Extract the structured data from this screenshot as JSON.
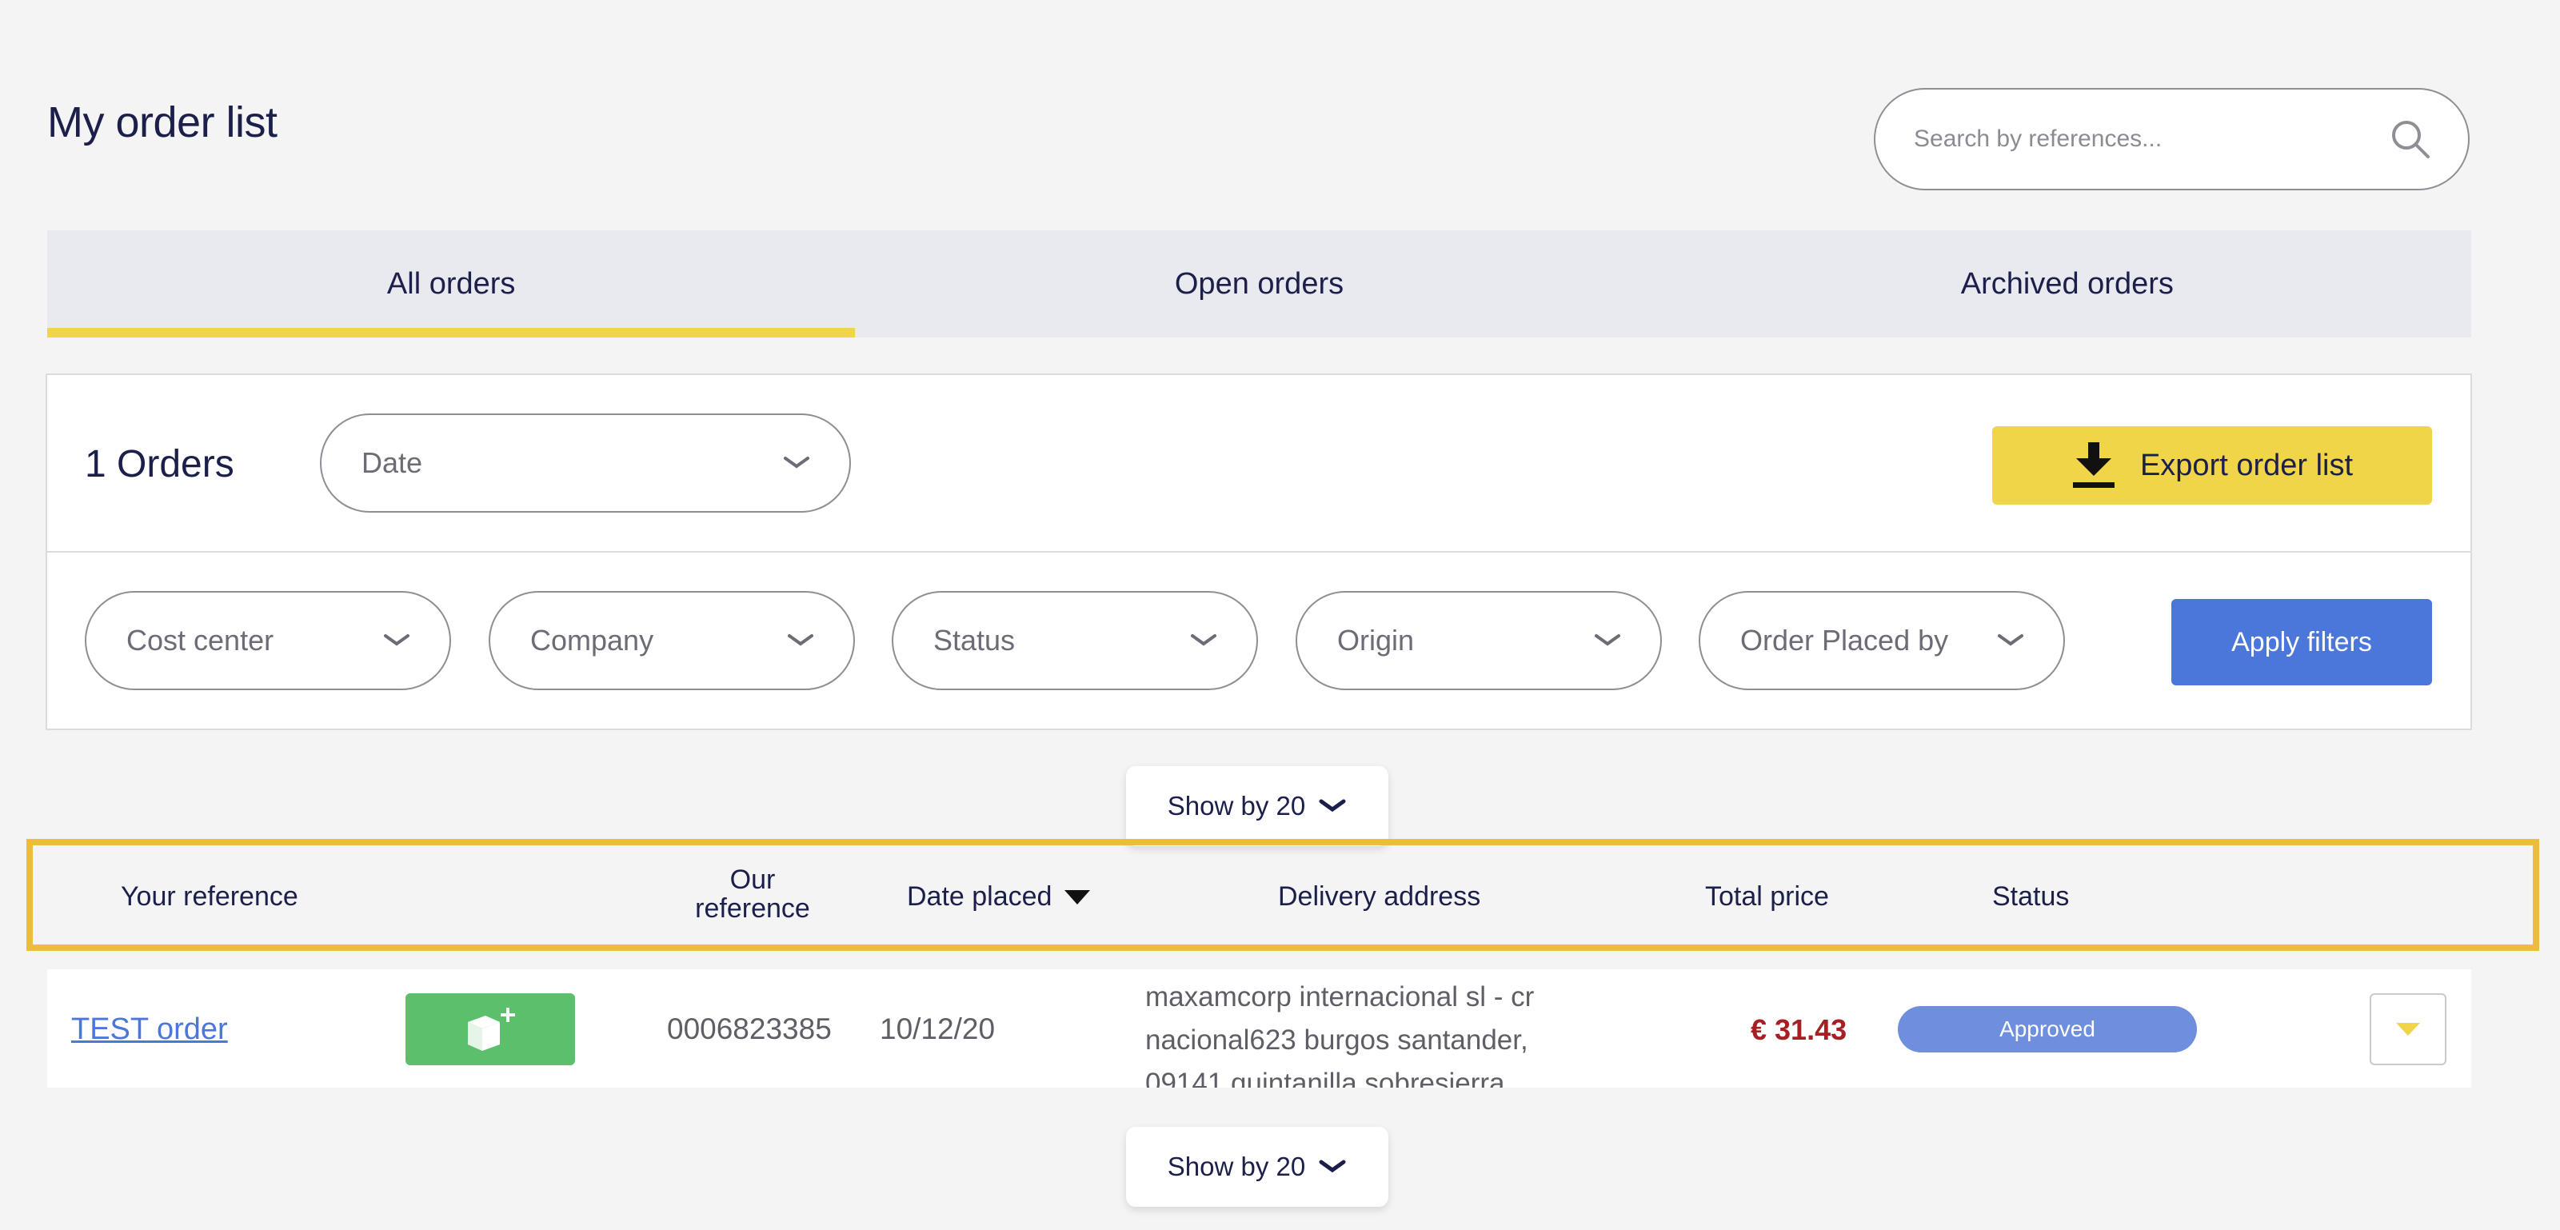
{
  "page": {
    "title": "My order list"
  },
  "search": {
    "placeholder": "Search by references..."
  },
  "tabs": [
    {
      "label": "All orders",
      "active": true
    },
    {
      "label": "Open orders",
      "active": false
    },
    {
      "label": "Archived orders",
      "active": false
    }
  ],
  "filters": {
    "orders_count": "1 Orders",
    "date_label": "Date",
    "export_label": "Export order list",
    "cost_center_label": "Cost center",
    "company_label": "Company",
    "status_label": "Status",
    "origin_label": "Origin",
    "placed_by_label": "Order Placed by",
    "apply_label": "Apply filters"
  },
  "pagination": {
    "show_by_label": "Show by 20"
  },
  "table": {
    "headers": {
      "your_reference": "Your reference",
      "our_reference_line1": "Our",
      "our_reference_line2": "reference",
      "date_placed": "Date placed",
      "delivery_address": "Delivery address",
      "total_price": "Total price",
      "status": "Status"
    },
    "rows": [
      {
        "your_reference": "TEST order",
        "our_reference": "0006823385",
        "date_placed": "10/12/20",
        "delivery_address": "maxamcorp internacional sl - cr nacional623 burgos santander, 09141 quintanilla sobresierra",
        "total_price": "€ 31.43",
        "status": "Approved"
      }
    ]
  },
  "colors": {
    "accent_yellow": "#f0d548",
    "primary_blue": "#4b77db",
    "success_green": "#5cbf6c",
    "price_red": "#a51f25",
    "badge_blue": "#6e8fdd",
    "highlight_border": "#ecbd3d"
  },
  "icons": {
    "search": "search-icon",
    "download": "download-icon",
    "chevron": "chevron-down-icon",
    "sort": "sort-desc-icon",
    "add_box": "add-box-icon",
    "expand": "caret-down-icon"
  }
}
